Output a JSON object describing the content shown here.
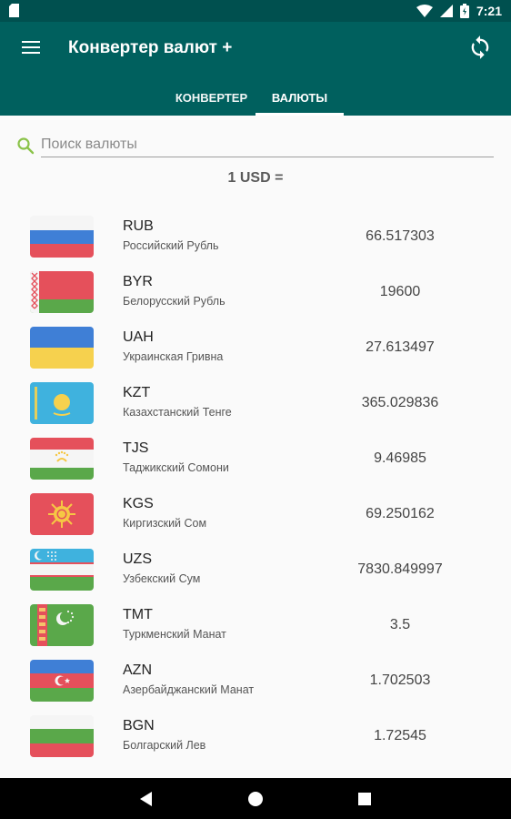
{
  "status_bar": {
    "time": "7:21",
    "icons": [
      "sd-card-icon",
      "wifi-icon",
      "signal-icon",
      "battery-icon"
    ]
  },
  "app_bar": {
    "title": "Конвертер валют +",
    "menu_icon": "menu-icon",
    "refresh_icon": "refresh-icon"
  },
  "tabs": [
    {
      "label": "КОНВЕРТЕР",
      "selected": false
    },
    {
      "label": "ВАЛЮТЫ",
      "selected": true
    }
  ],
  "search": {
    "placeholder": "Поиск валюты",
    "value": ""
  },
  "base_label": "1 USD =",
  "currencies": [
    {
      "code": "RUB",
      "name": "Российский Рубль",
      "rate": "66.517303",
      "flag": "russia-flag"
    },
    {
      "code": "BYR",
      "name": "Белорусский Рубль",
      "rate": "19600",
      "flag": "belarus-flag"
    },
    {
      "code": "UAH",
      "name": "Украинская Гривна",
      "rate": "27.613497",
      "flag": "ukraine-flag"
    },
    {
      "code": "KZT",
      "name": "Казахстанский Тенге",
      "rate": "365.029836",
      "flag": "kazakhstan-flag"
    },
    {
      "code": "TJS",
      "name": "Таджикский Сомони",
      "rate": "9.46985",
      "flag": "tajikistan-flag"
    },
    {
      "code": "KGS",
      "name": "Киргизский Сом",
      "rate": "69.250162",
      "flag": "kyrgyzstan-flag"
    },
    {
      "code": "UZS",
      "name": "Узбекский Сум",
      "rate": "7830.849997",
      "flag": "uzbekistan-flag"
    },
    {
      "code": "TMT",
      "name": "Туркменский Манат",
      "rate": "3.5",
      "flag": "turkmenistan-flag"
    },
    {
      "code": "AZN",
      "name": "Азербайджанский Манат",
      "rate": "1.702503",
      "flag": "azerbaijan-flag"
    },
    {
      "code": "BGN",
      "name": "Болгарский Лев",
      "rate": "1.72545",
      "flag": "bulgaria-flag"
    }
  ],
  "nav_bar": {
    "buttons": [
      "back-icon",
      "home-icon",
      "recents-icon"
    ]
  },
  "colors": {
    "status_bar": "#00504f",
    "app_bar": "#00605e",
    "accent": "#8bc34a",
    "background": "#fafafa"
  }
}
